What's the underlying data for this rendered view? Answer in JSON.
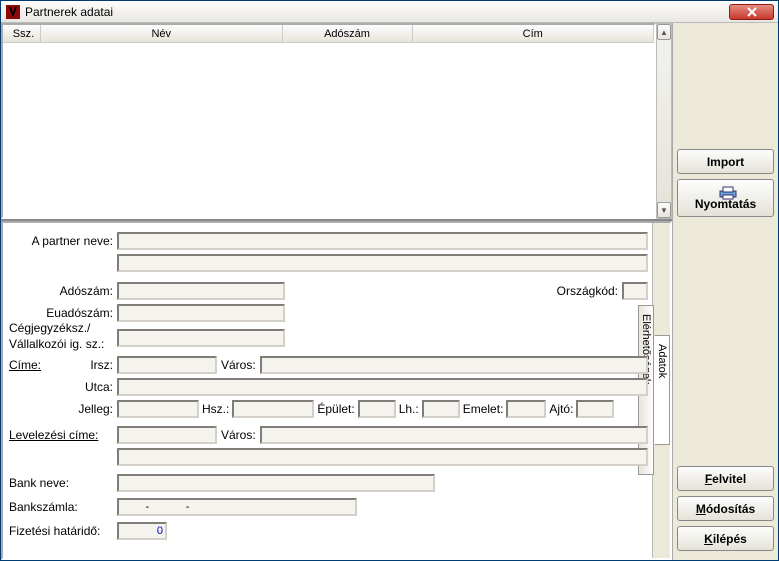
{
  "window": {
    "title": "Partnerek adatai"
  },
  "grid": {
    "columns": {
      "ssz": "Ssz.",
      "nev": "Név",
      "adoszam": "Adószám",
      "cim": "Cím"
    }
  },
  "tabs": {
    "adatok": "Adatok",
    "elerhetosegek": "Elérhetőségek"
  },
  "form": {
    "partner_neve_label": "A partner neve:",
    "adoszam_label": "Adószám:",
    "orszagkod_label": "Országkód:",
    "euadoszam_label": "Euadószám:",
    "cegjegyzek_label": "Cégjegyzéksz./",
    "vallalkozoi_label": "Vállalkozói ig. sz.:",
    "cime_label": "Címe:",
    "irsz_label": "Irsz:",
    "varos_label": "Város:",
    "utca_label": "Utca:",
    "jelleg_label": "Jelleg:",
    "hsz_label": "Hsz.:",
    "epulet_label": "Épület:",
    "lh_label": "Lh.:",
    "emelet_label": "Emelet:",
    "ajto_label": "Ajtó:",
    "levelezesi_label": "Levelezési címe:",
    "bank_neve_label": "Bank neve:",
    "bankszamla_label": "Bankszámla:",
    "bankszamla_value": "        -            -",
    "fizetesi_label": "Fizetési határidő:",
    "fizetesi_value": "0"
  },
  "buttons": {
    "import": "Import",
    "nyomtatas": "Nyomtatás",
    "felvitel_pre": "",
    "felvitel_u": "F",
    "felvitel_post": "elvitel",
    "modositas_pre": "",
    "modositas_u": "M",
    "modositas_post": "ódosítás",
    "kilepes_pre": "",
    "kilepes_u": "K",
    "kilepes_post": "ilépés"
  }
}
